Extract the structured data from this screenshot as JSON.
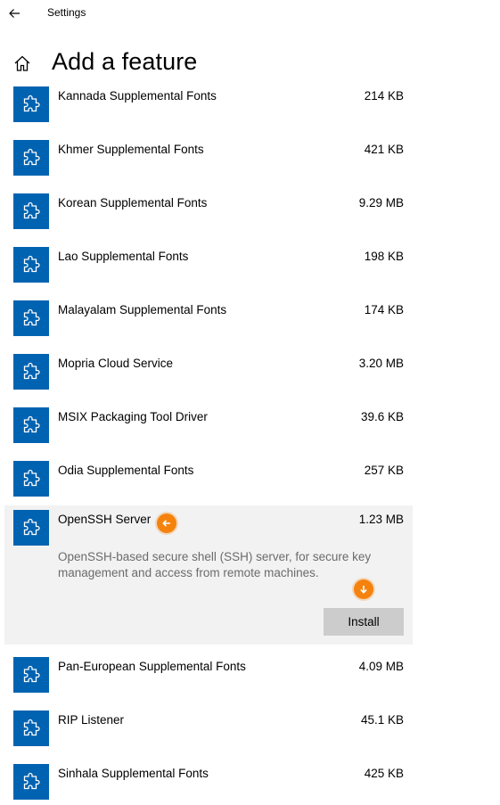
{
  "window": {
    "app_title": "Settings",
    "back_icon": "back-arrow-icon"
  },
  "header": {
    "home_icon": "home-icon",
    "title": "Add a feature"
  },
  "accent_color": "#0063b1",
  "marker_color": "#f5820d",
  "features": [
    {
      "name": "Kannada Supplemental Fonts",
      "size": "214 KB"
    },
    {
      "name": "Khmer Supplemental Fonts",
      "size": "421 KB"
    },
    {
      "name": "Korean Supplemental Fonts",
      "size": "9.29 MB"
    },
    {
      "name": "Lao Supplemental Fonts",
      "size": "198 KB"
    },
    {
      "name": "Malayalam Supplemental Fonts",
      "size": "174 KB"
    },
    {
      "name": "Mopria Cloud Service",
      "size": "3.20 MB"
    },
    {
      "name": "MSIX Packaging Tool Driver",
      "size": "39.6 KB"
    },
    {
      "name": "Odia Supplemental Fonts",
      "size": "257 KB"
    },
    {
      "name": "OpenSSH Server",
      "size": "1.23 MB",
      "expanded": true,
      "description": "OpenSSH-based secure shell (SSH) server, for secure key management and access from remote machines.",
      "install_label": "Install"
    },
    {
      "name": "Pan-European Supplemental Fonts",
      "size": "4.09 MB"
    },
    {
      "name": "RIP Listener",
      "size": "45.1 KB"
    },
    {
      "name": "Sinhala Supplemental Fonts",
      "size": "425 KB"
    }
  ]
}
